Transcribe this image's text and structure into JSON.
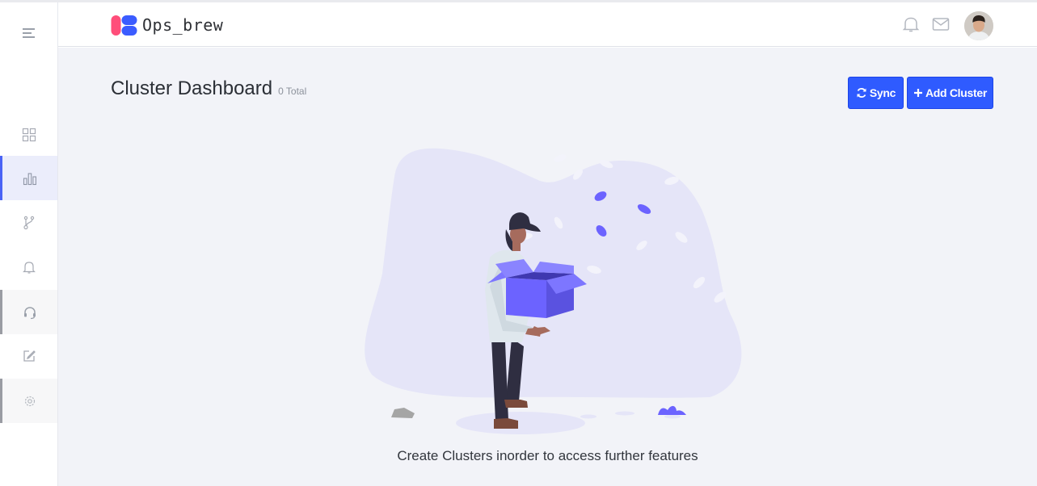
{
  "app": {
    "brand": "Ops_brew"
  },
  "sidebar": {
    "items": [
      {
        "name": "menu",
        "icon": "menu-icon"
      },
      {
        "name": "dashboard",
        "icon": "grid-icon"
      },
      {
        "name": "clusters",
        "icon": "bar-chart-icon",
        "active": true
      },
      {
        "name": "git",
        "icon": "git-branch-icon"
      },
      {
        "name": "alerts",
        "icon": "bell-icon"
      },
      {
        "name": "support",
        "icon": "headset-icon"
      },
      {
        "name": "edit",
        "icon": "edit-icon"
      },
      {
        "name": "settings",
        "icon": "gear-icon"
      }
    ]
  },
  "header": {
    "icons": [
      "bell-icon",
      "mail-icon",
      "avatar"
    ]
  },
  "page": {
    "title": "Cluster Dashboard",
    "total_count": "0 Total",
    "sync_label": "Sync",
    "add_cluster_label": "Add Cluster",
    "empty_message": "Create Clusters inorder to access further features"
  },
  "colors": {
    "accent": "#2f5bff",
    "logo_pink": "#ff4e7a",
    "logo_blue": "#3b5cff",
    "illustration_purple": "#6c63ff",
    "blob": "#e5e5f8"
  }
}
